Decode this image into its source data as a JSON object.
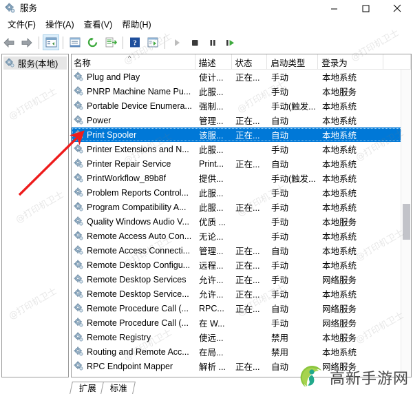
{
  "window": {
    "title": "服务",
    "icon": "services-gear-icon",
    "controls": {
      "minimize": "最小化",
      "maximize": "最大化",
      "close": "关闭"
    }
  },
  "menubar": {
    "items": [
      {
        "label": "文件(F)",
        "name": "menu-file"
      },
      {
        "label": "操作(A)",
        "name": "menu-action"
      },
      {
        "label": "查看(V)",
        "name": "menu-view"
      },
      {
        "label": "帮助(H)",
        "name": "menu-help"
      }
    ]
  },
  "toolbar": {
    "buttons": [
      {
        "name": "back-icon",
        "label": "后退"
      },
      {
        "name": "forward-icon",
        "label": "前进"
      },
      {
        "name": "show-hide-console-tree-icon",
        "label": "显示/隐藏控制台树"
      },
      {
        "name": "properties-icon",
        "label": "属性"
      },
      {
        "name": "refresh-icon",
        "label": "刷新"
      },
      {
        "name": "export-list-icon",
        "label": "导出列表"
      },
      {
        "name": "help-icon",
        "label": "帮助"
      },
      {
        "name": "new-window-icon",
        "label": "新建窗口"
      },
      {
        "name": "start-service-icon",
        "label": "启动服务"
      },
      {
        "name": "stop-service-icon",
        "label": "停止服务"
      },
      {
        "name": "pause-service-icon",
        "label": "暂停服务"
      },
      {
        "name": "restart-service-icon",
        "label": "重启服务"
      }
    ]
  },
  "tree": {
    "items": [
      {
        "label": "服务(本地)",
        "name": "tree-item-services-local",
        "icon": "gear-icon",
        "selected": true
      }
    ]
  },
  "list": {
    "columns": [
      {
        "label": "名称",
        "name": "column-name"
      },
      {
        "label": "描述",
        "name": "column-description"
      },
      {
        "label": "状态",
        "name": "column-status"
      },
      {
        "label": "启动类型",
        "name": "column-startup-type"
      },
      {
        "label": "登录为",
        "name": "column-log-on-as"
      }
    ],
    "sort_indicator": "^",
    "rows": [
      {
        "name": "Plug and Play",
        "description": "使计...",
        "status": "正在...",
        "startup": "手动",
        "logon": "本地系统",
        "selected": false
      },
      {
        "name": "PNRP Machine Name Pu...",
        "description": "此服...",
        "status": "",
        "startup": "手动",
        "logon": "本地服务",
        "selected": false
      },
      {
        "name": "Portable Device Enumera...",
        "description": "强制...",
        "status": "",
        "startup": "手动(触发...",
        "logon": "本地系统",
        "selected": false
      },
      {
        "name": "Power",
        "description": "管理...",
        "status": "正在...",
        "startup": "自动",
        "logon": "本地系统",
        "selected": false
      },
      {
        "name": "Print Spooler",
        "description": "该服...",
        "status": "正在...",
        "startup": "自动",
        "logon": "本地系统",
        "selected": true
      },
      {
        "name": "Printer Extensions and N...",
        "description": "此服...",
        "status": "",
        "startup": "手动",
        "logon": "本地系统",
        "selected": false
      },
      {
        "name": "Printer Repair Service",
        "description": "Print...",
        "status": "正在...",
        "startup": "自动",
        "logon": "本地系统",
        "selected": false
      },
      {
        "name": "PrintWorkflow_89b8f",
        "description": "提供...",
        "status": "",
        "startup": "手动(触发...",
        "logon": "本地系统",
        "selected": false
      },
      {
        "name": "Problem Reports Control...",
        "description": "此服...",
        "status": "",
        "startup": "手动",
        "logon": "本地系统",
        "selected": false
      },
      {
        "name": "Program Compatibility A...",
        "description": "此服...",
        "status": "正在...",
        "startup": "手动",
        "logon": "本地系统",
        "selected": false
      },
      {
        "name": "Quality Windows Audio V...",
        "description": "优质 ...",
        "status": "",
        "startup": "手动",
        "logon": "本地服务",
        "selected": false
      },
      {
        "name": "Remote Access Auto Con...",
        "description": "无论...",
        "status": "",
        "startup": "手动",
        "logon": "本地系统",
        "selected": false
      },
      {
        "name": "Remote Access Connecti...",
        "description": "管理...",
        "status": "正在...",
        "startup": "自动",
        "logon": "本地系统",
        "selected": false
      },
      {
        "name": "Remote Desktop Configu...",
        "description": "远程...",
        "status": "正在...",
        "startup": "手动",
        "logon": "本地系统",
        "selected": false
      },
      {
        "name": "Remote Desktop Services",
        "description": "允许...",
        "status": "正在...",
        "startup": "手动",
        "logon": "网络服务",
        "selected": false
      },
      {
        "name": "Remote Desktop Service...",
        "description": "允许...",
        "status": "正在...",
        "startup": "手动",
        "logon": "本地系统",
        "selected": false
      },
      {
        "name": "Remote Procedure Call (...",
        "description": "RPC...",
        "status": "正在...",
        "startup": "自动",
        "logon": "网络服务",
        "selected": false
      },
      {
        "name": "Remote Procedure Call (...",
        "description": "在 W...",
        "status": "",
        "startup": "手动",
        "logon": "网络服务",
        "selected": false
      },
      {
        "name": "Remote Registry",
        "description": "使远...",
        "status": "",
        "startup": "禁用",
        "logon": "本地服务",
        "selected": false
      },
      {
        "name": "Routing and Remote Acc...",
        "description": "在局...",
        "status": "",
        "startup": "禁用",
        "logon": "本地系统",
        "selected": false
      },
      {
        "name": "RPC Endpoint Mapper",
        "description": "解析 ...",
        "status": "正在...",
        "startup": "自动",
        "logon": "网络服务",
        "selected": false
      }
    ]
  },
  "tabs": [
    {
      "label": "扩展",
      "name": "tab-extended",
      "active": false
    },
    {
      "label": "标准",
      "name": "tab-standard",
      "active": true
    }
  ],
  "watermarks": {
    "text": "@打印机卫士",
    "logo_text": "高新手游网"
  },
  "colors": {
    "selection": "#0078d7",
    "annotation_arrow": "#ee1c1c",
    "toolbar_active": "#dbeefb"
  }
}
